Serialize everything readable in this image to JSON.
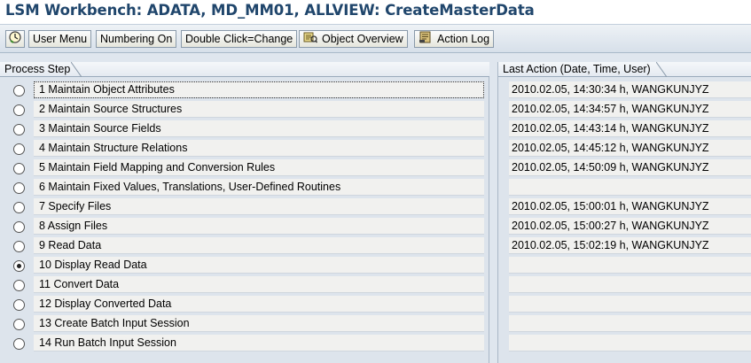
{
  "window_title": "LSM Workbench: ADATA, MD_MM01, ALLVIEW: CreateMasterData",
  "toolbar": {
    "execute_icon": "execute-clock-icon",
    "user_menu_label": "User Menu",
    "numbering_on_label": "Numbering On",
    "double_click_label": "Double Click=Change",
    "object_overview_label": "Object Overview",
    "object_overview_icon": "overview-icon",
    "action_log_label": "Action Log",
    "action_log_icon": "log-icon"
  },
  "process_step_header": "Process Step",
  "last_action_header": "Last Action (Date, Time, User)",
  "selected_step": 10,
  "steps": [
    {
      "label": "1 Maintain Object Attributes",
      "last_action": "2010.02.05, 14:30:34 h, WANGKUNJYZ"
    },
    {
      "label": "2 Maintain Source Structures",
      "last_action": "2010.02.05, 14:34:57 h, WANGKUNJYZ"
    },
    {
      "label": "3 Maintain Source Fields",
      "last_action": "2010.02.05, 14:43:14 h, WANGKUNJYZ"
    },
    {
      "label": "4 Maintain Structure Relations",
      "last_action": "2010.02.05, 14:45:12 h, WANGKUNJYZ"
    },
    {
      "label": "5 Maintain Field Mapping and Conversion Rules",
      "last_action": "2010.02.05, 14:50:09 h, WANGKUNJYZ"
    },
    {
      "label": "6 Maintain Fixed Values, Translations, User-Defined Routines",
      "last_action": ""
    },
    {
      "label": "7 Specify Files",
      "last_action": "2010.02.05, 15:00:01 h, WANGKUNJYZ"
    },
    {
      "label": "8 Assign Files",
      "last_action": "2010.02.05, 15:00:27 h, WANGKUNJYZ"
    },
    {
      "label": "9 Read Data",
      "last_action": "2010.02.05, 15:02:19 h, WANGKUNJYZ"
    },
    {
      "label": "10 Display Read Data",
      "last_action": ""
    },
    {
      "label": "11 Convert Data",
      "last_action": ""
    },
    {
      "label": "12 Display Converted Data",
      "last_action": ""
    },
    {
      "label": "13 Create Batch Input Session",
      "last_action": ""
    },
    {
      "label": "14 Run Batch Input Session",
      "last_action": ""
    }
  ]
}
